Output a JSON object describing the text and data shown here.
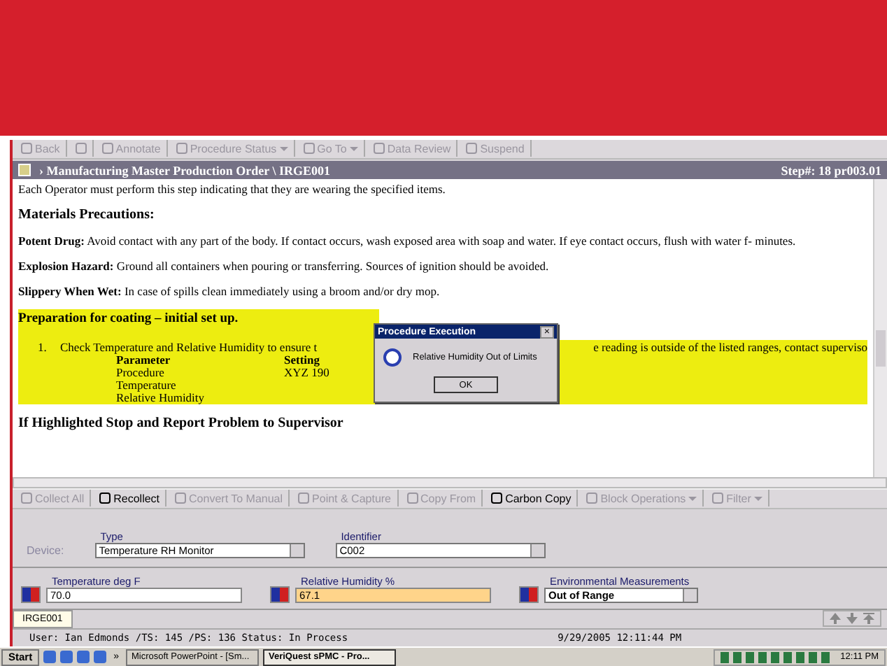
{
  "toolbar": [
    {
      "label": "Back",
      "disabled": true,
      "menu": false
    },
    {
      "disabled": true,
      "menu": false
    },
    {
      "label": "Annotate",
      "disabled": true,
      "menu": false
    },
    {
      "label": "Procedure Status",
      "disabled": true,
      "menu": true
    },
    {
      "label": "Go To",
      "disabled": true,
      "menu": true
    },
    {
      "label": "Data Review",
      "disabled": true,
      "menu": false
    },
    {
      "label": "Suspend",
      "disabled": true,
      "menu": false
    }
  ],
  "document": {
    "title": "› Manufacturing Master Production Order \\ IRGE001",
    "step": "Step#: 18  pr003.01",
    "blocks": [
      {
        "kind": "text",
        "text": "Each Operator must perform this step indicating that they are wearing the specified items."
      },
      {
        "kind": "heading",
        "text": "Materials Precautions:"
      },
      {
        "kind": "text",
        "text": "**Potent Drug:** Avoid contact with any part of the body. If contact occurs, wash exposed area with soap and water. If eye contact occurs, flush with water f- minutes."
      },
      {
        "kind": "text",
        "text": "**Explosion Hazard:** Ground all containers when pouring or transferring. Sources of ignition should be avoided."
      },
      {
        "kind": "text",
        "text": "**Slippery When Wet:** In case of spills clean immediately using a broom and/or dry mop."
      },
      {
        "kind": "highlight",
        "text": "Preparation for coating – initial set up."
      },
      {
        "kind": "step",
        "number": "1.",
        "text_before": "Check Temperature and Relative Humidity to ensure t",
        "text_after": "e reading is outside of the listed ranges, contact superviso",
        "table": {
          "columns": [
            "Parameter",
            "Setting"
          ],
          "rows": [
            [
              "Procedure",
              "XYZ 190"
            ],
            [
              "Temperature",
              ""
            ],
            [
              "Relative Humidity",
              ""
            ]
          ]
        }
      },
      {
        "kind": "heading",
        "text": "If Highlighted Stop and Report Problem to Supervisor"
      }
    ]
  },
  "dialog": {
    "title": "Procedure Execution",
    "close": "×",
    "message": "Relative Humidity Out of Limits",
    "button": "OK"
  },
  "actions": [
    {
      "label": "Collect All",
      "disabled": true,
      "menu": false
    },
    {
      "label": "Recollect",
      "disabled": false,
      "menu": false
    },
    {
      "label": "Convert To Manual",
      "disabled": true,
      "menu": false
    },
    {
      "label": "Point & Capture",
      "disabled": true,
      "menu": false
    },
    {
      "label": "Copy From",
      "disabled": true,
      "menu": false
    },
    {
      "label": "Carbon Copy",
      "disabled": false,
      "menu": false
    },
    {
      "label": "Block Operations",
      "disabled": true,
      "menu": true
    },
    {
      "label": "Filter",
      "disabled": true,
      "menu": true
    }
  ],
  "device": {
    "label": "Device:",
    "fields": [
      {
        "label": "Type",
        "value": "Temperature RH Monitor"
      },
      {
        "label": "Identifier",
        "value": "C002"
      }
    ]
  },
  "measurements": [
    {
      "label": "Temperature  deg F",
      "value": "70.0",
      "kind": "input",
      "out_of_range": false
    },
    {
      "label": "Relative Humidity %",
      "value": "67.1",
      "kind": "input",
      "out_of_range": true
    },
    {
      "label": "Environmental Measurements",
      "value": "Out of Range",
      "kind": "select",
      "out_of_range": false
    }
  ],
  "tabs": [
    {
      "label": "IRGE001",
      "selected": true
    }
  ],
  "status_bar": {
    "left": "User: Ian Edmonds /TS: 145 /PS: 136 Status: In Process",
    "right": "9/29/2005  12:11:44 PM"
  },
  "taskbar": {
    "start": "Start",
    "more": "»",
    "tasks": [
      {
        "label": "Microsoft PowerPoint - [Sm...",
        "selected": false
      },
      {
        "label": "VeriQuest sPMC - Pro...",
        "selected": true
      }
    ],
    "clock": "12:11 PM"
  }
}
